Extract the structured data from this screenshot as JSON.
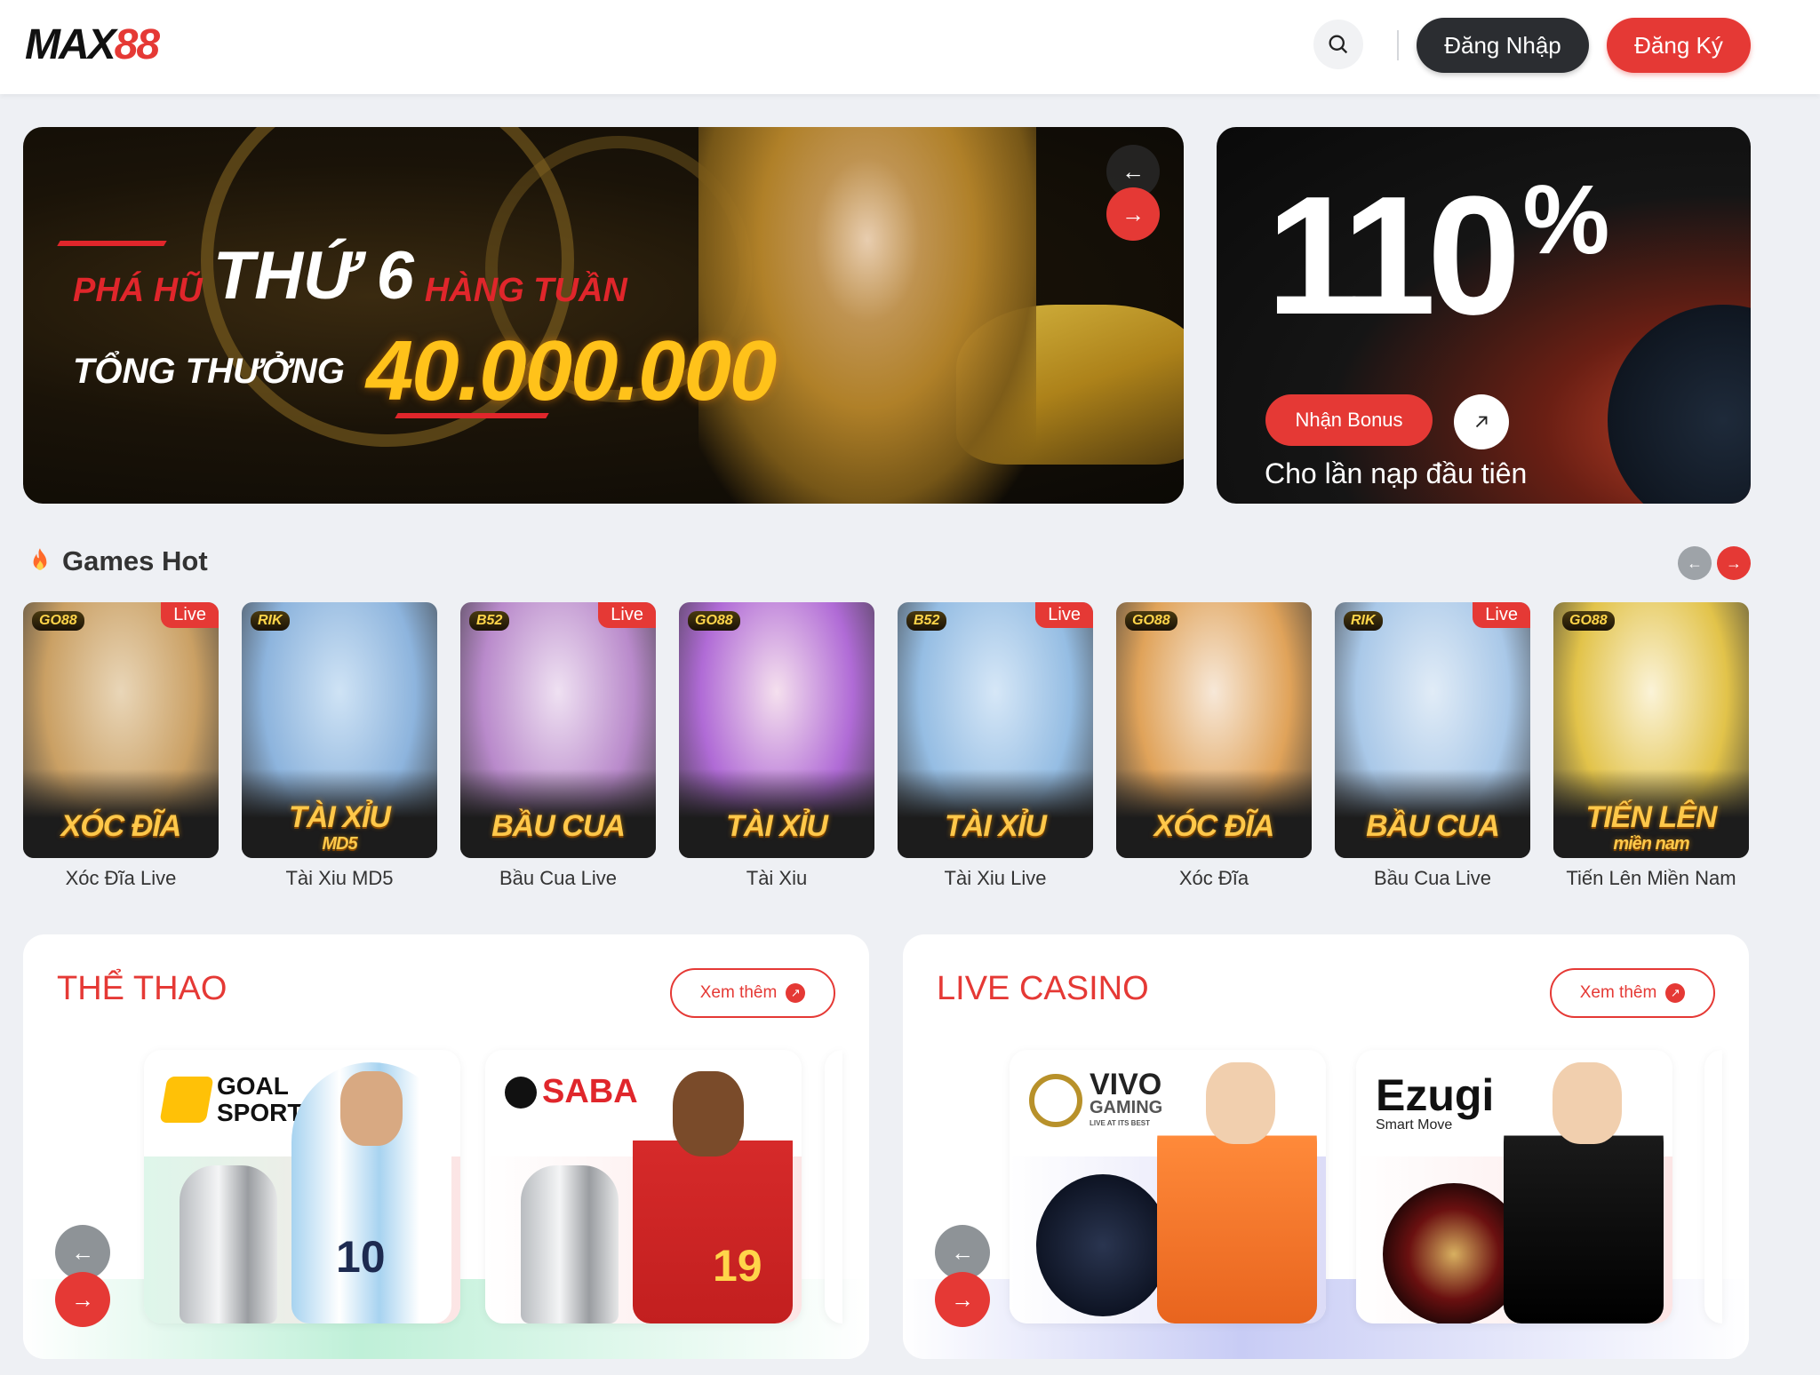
{
  "header": {
    "logo_text": "MAX",
    "logo_num": "88",
    "search_icon": "search-icon",
    "login_label": "Đăng Nhập",
    "register_label": "Đăng Ký"
  },
  "banner": {
    "line1_left": "PHÁ HŨ",
    "line1_big": "THỨ 6",
    "line1_right": "HÀNG TUẦN",
    "line2_label": "TỔNG THƯỞNG",
    "amount": "40.000.000",
    "prev_icon": "arrow-left-icon",
    "next_icon": "arrow-right-icon",
    "slides": 3,
    "active_slide": 1
  },
  "promo": {
    "percent": "110",
    "percent_sign": "%",
    "subtitle": "Cho lần nạp đầu tiên",
    "button_label": "Nhận Bonus",
    "arrow_icon": "arrow-up-right-icon"
  },
  "games_hot": {
    "title": "Games Hot",
    "title_icon": "fire-icon",
    "games": [
      {
        "name": "Xóc Đĩa Live",
        "art_title": "XÓC ĐĨA",
        "brand": "GO88",
        "live": "Live"
      },
      {
        "name": "Tài Xiu MD5",
        "art_title": "TÀI XỈU",
        "art_sub": "MD5",
        "brand": "RIK",
        "live": ""
      },
      {
        "name": "Bầu Cua Live",
        "art_title": "BẦU CUA",
        "brand": "B52",
        "live": "Live"
      },
      {
        "name": "Tài Xiu",
        "art_title": "TÀI XỈU",
        "brand": "GO88",
        "live": ""
      },
      {
        "name": "Tài Xiu Live",
        "art_title": "TÀI XỈU",
        "brand": "B52",
        "live": "Live"
      },
      {
        "name": "Xóc Đĩa",
        "art_title": "XÓC ĐĨA",
        "brand": "GO88",
        "live": ""
      },
      {
        "name": "Bầu Cua Live",
        "art_title": "BẦU CUA",
        "brand": "RIK",
        "live": "Live"
      },
      {
        "name": "Tiến Lên Miền Nam",
        "art_title": "TIẾN LÊN",
        "art_sub": "miền nam",
        "brand": "GO88",
        "live": ""
      }
    ]
  },
  "sports": {
    "title": "THỂ THAO",
    "more_label": "Xem thêm",
    "providers": [
      {
        "logo": "GOAL SPORT",
        "jersey": "10"
      },
      {
        "logo": "SABA",
        "jersey": "19"
      }
    ]
  },
  "casino": {
    "title": "LIVE CASINO",
    "more_label": "Xem thêm",
    "providers": [
      {
        "logo": "VIVO",
        "logo_sub": "GAMING",
        "tagline": "LIVE AT ITS BEST"
      },
      {
        "logo": "Ezugi",
        "tagline": "Smart Move"
      }
    ]
  },
  "colors": {
    "accent": "#e53935",
    "dark_button": "#2b2d31",
    "page_bg": "#eef0f4"
  }
}
